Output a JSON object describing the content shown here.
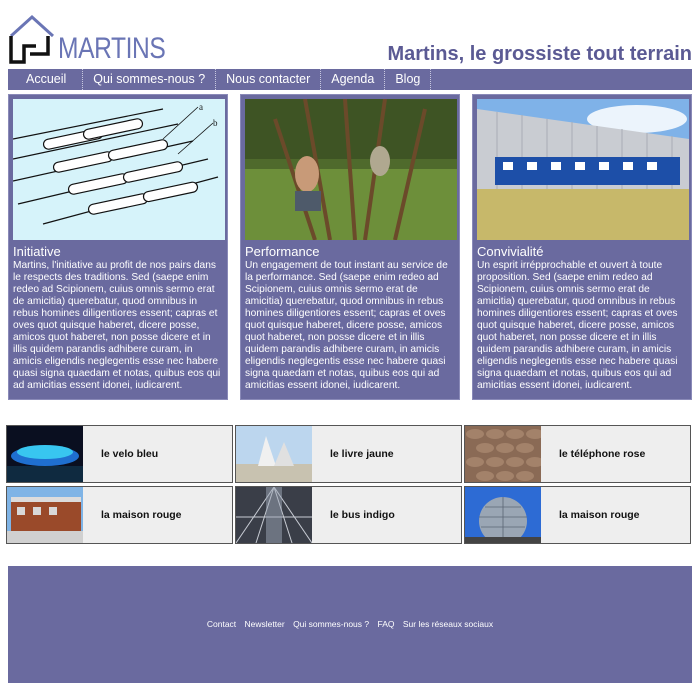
{
  "brand": {
    "name": "MARTINS",
    "tagline": "Martins, le grossiste tout terrain"
  },
  "nav": [
    {
      "label": "Accueil"
    },
    {
      "label": "Qui sommes-nous ?"
    },
    {
      "label": "Nous contacter"
    },
    {
      "label": "Agenda"
    },
    {
      "label": "Blog"
    }
  ],
  "features": [
    {
      "title": "Initiative",
      "text": "Martins, l'initiative au profit de nos pairs dans le respects des traditions. Sed (saepe enim redeo ad Scipionem, cuius omnis sermo erat de amicitia) querebatur, quod omnibus in rebus homines diligentiores essent; capras et oves quot quisque haberet, dicere posse, amicos quot haberet, non posse dicere et in illis quidem parandis adhibere curam, in amicis eligendis neglegentis esse nec habere quasi signa quaedam et notas, quibus eos qui ad amicitias essent idonei, iudicarent.",
      "diagram_labels": [
        "a",
        "b"
      ]
    },
    {
      "title": "Performance",
      "text": "Un engagement de tout instant au service de la performance. Sed (saepe enim redeo ad Scipionem, cuius omnis sermo erat de amicitia) querebatur, quod omnibus in rebus homines diligentiores essent; capras et oves quot quisque haberet, dicere posse, amicos quot haberet, non posse dicere et in illis quidem parandis adhibere curam, in amicis eligendis neglegentis esse nec habere quasi signa quaedam et notas, quibus eos qui ad amicitias essent idonei, iudicarent."
    },
    {
      "title": "Convivialité",
      "text": "Un esprit irrépprochable et ouvert à toute proposition. Sed (saepe enim redeo ad Scipionem, cuius omnis sermo erat de amicitia) querebatur, quod omnibus in rebus homines diligentiores essent; capras et oves quot quisque haberet, dicere posse, amicos quot haberet, non posse dicere et in illis quidem parandis adhibere curam, in amicis eligendis neglegentis esse nec habere quasi signa quaedam et notas, quibus eos qui ad amicitias essent idonei, iudicarent."
    }
  ],
  "tiles": [
    {
      "label": "le velo bleu"
    },
    {
      "label": "le livre jaune"
    },
    {
      "label": "le téléphone rose"
    },
    {
      "label": "la maison rouge"
    },
    {
      "label": "le bus indigo"
    },
    {
      "label": "la maison rouge"
    }
  ],
  "footer": {
    "links": [
      "Contact",
      "Newsletter",
      "Qui sommes-nous ?",
      "FAQ",
      "Sur les réseaux sociaux"
    ]
  },
  "colors": {
    "panel": "#6a6a9f",
    "brand": "#6a75b5",
    "tagline": "#5b5a94"
  }
}
